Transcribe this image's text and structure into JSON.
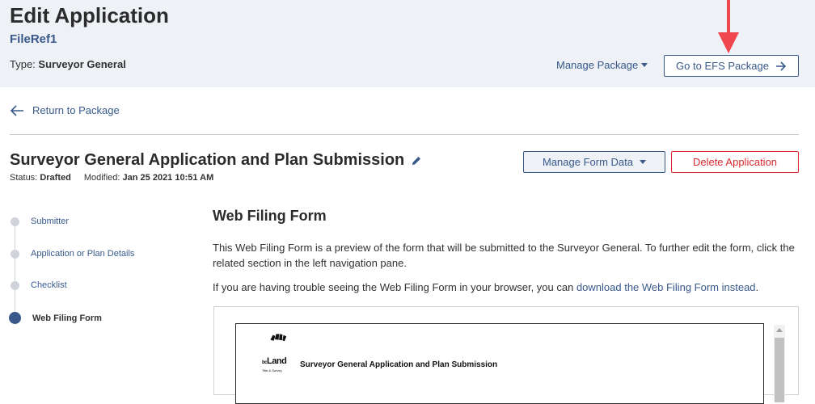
{
  "header": {
    "title": "Edit Application",
    "file_ref": "FileRef1",
    "type_label": "Type:",
    "type_value": "Surveyor General",
    "manage_package_label": "Manage Package",
    "go_to_efs_label": "Go to EFS Package"
  },
  "return_link": "Return to Package",
  "application": {
    "title": "Surveyor General Application and Plan Submission",
    "status_label": "Status:",
    "status_value": "Drafted",
    "modified_label": "Modified:",
    "modified_value": "Jan 25 2021 10:51 AM",
    "manage_form_data_label": "Manage Form Data",
    "delete_label": "Delete Application"
  },
  "nav": {
    "items": [
      {
        "label": "Submitter"
      },
      {
        "label": "Application or Plan Details"
      },
      {
        "label": "Checklist"
      },
      {
        "label": "Web Filing Form"
      }
    ]
  },
  "web_filing": {
    "title": "Web Filing Form",
    "description": "This Web Filing Form is a preview of the form that will be submitted to the Surveyor General. To further edit the form, click the related section in the left navigation pane.",
    "trouble_text": "If you are having trouble seeing the Web Filing Form in your browser, you can ",
    "download_link": "download the Web Filing Form instead",
    "trouble_end": "."
  },
  "preview": {
    "logo_brand": "Land",
    "logo_prefix": "bc",
    "logo_sub": "Title & Survey",
    "heading": "Surveyor General Application and Plan Submission"
  },
  "colors": {
    "header_bg": "#eef1f6",
    "primary": "#38598a",
    "danger": "#d8292f",
    "annotation_arrow": "#f0474f"
  }
}
